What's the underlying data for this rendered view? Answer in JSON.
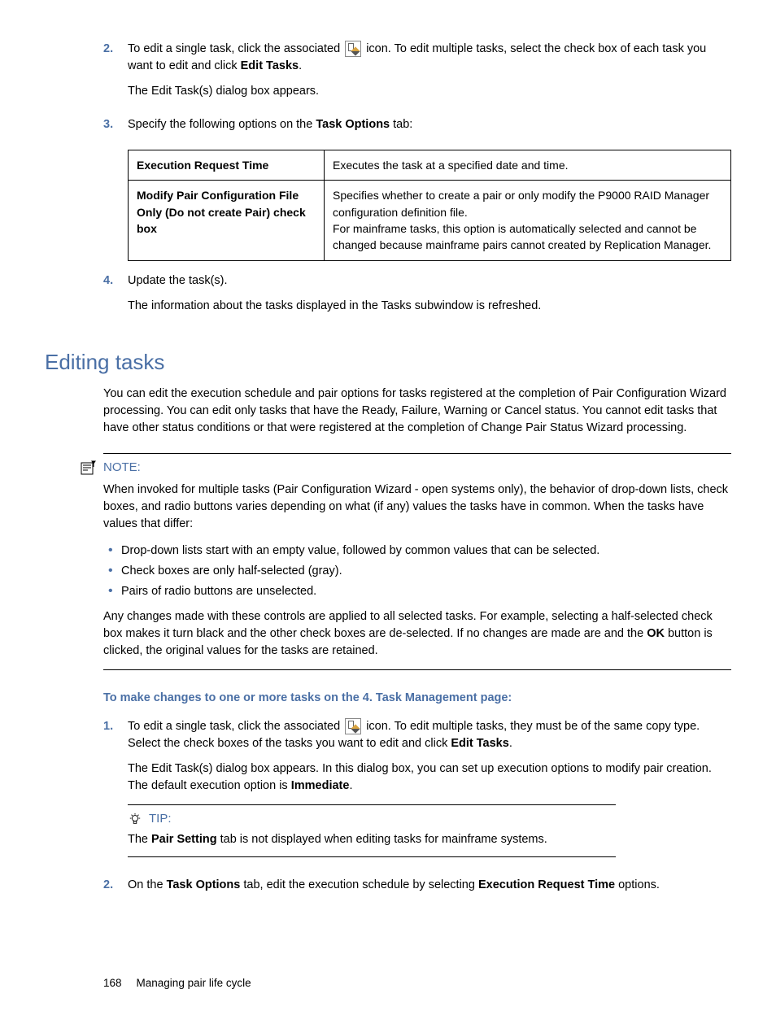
{
  "steps_top": {
    "s2": {
      "marker": "2.",
      "text_a": "To edit a single task, click the associated ",
      "text_b": " icon. To edit multiple tasks, select the check box of each task you want to edit and click ",
      "bold_b": "Edit Tasks",
      "text_c": ".",
      "p2": "The Edit Task(s) dialog box appears."
    },
    "s3": {
      "marker": "3.",
      "text_a": "Specify the following options on the ",
      "bold_a": "Task Options",
      "text_b": " tab:"
    },
    "s4": {
      "marker": "4.",
      "text_a": "Update the task(s).",
      "p2": "The information about the tasks displayed in the Tasks subwindow is refreshed."
    }
  },
  "table": {
    "r1h": "Execution Request Time",
    "r1v": "Executes the task at a specified date and time.",
    "r2h": "Modify Pair Configuration File Only (Do not create Pair) check box",
    "r2v_a": "Specifies whether to create a pair or only modify the P9000 RAID Manager configuration definition file.",
    "r2v_b": "For mainframe tasks, this option is automatically selected and cannot be changed because mainframe pairs cannot created by Replication Manager."
  },
  "heading": "Editing tasks",
  "intro": "You can edit the execution schedule and pair options for tasks registered at the completion of Pair Configuration Wizard processing. You can edit only tasks that have the Ready, Failure, Warning or Cancel status. You cannot edit tasks that have other status conditions or that were registered at the completion of Change Pair Status Wizard processing.",
  "note": {
    "label": "NOTE:",
    "p1": "When invoked for multiple tasks (Pair Configuration Wizard - open systems only), the behavior of drop-down lists, check boxes, and radio buttons varies depending on what (if any) values the tasks have in common. When the tasks have values that differ:",
    "b1": "Drop-down lists start with an empty value, followed by common values that can be selected.",
    "b2": "Check boxes are only half-selected (gray).",
    "b3": "Pairs of radio buttons are unselected.",
    "p2_a": "Any changes made with these controls are applied to all selected tasks. For example, selecting a half-selected check box makes it turn black and the other check boxes are de-selected. If no changes are made are and the ",
    "p2_bold": "OK",
    "p2_b": " button is clicked, the original values for the tasks are retained."
  },
  "procedure_head": "To make changes to one or more tasks on the 4. Task Management page:",
  "steps_bottom": {
    "s1": {
      "marker": "1.",
      "text_a": "To edit a single task, click the associated ",
      "text_b": " icon. To edit multiple tasks, they must be of the same copy type. Select the check boxes of the tasks you want to edit and click ",
      "bold_b": "Edit Tasks",
      "text_c": ".",
      "p2_a": "The Edit Task(s) dialog box appears. In this dialog box, you can set up execution options to modify pair creation. The default execution option is ",
      "p2_bold": "Immediate",
      "p2_b": "."
    },
    "s2": {
      "marker": "2.",
      "text_a": "On the ",
      "bold_a": "Task Options",
      "text_b": " tab, edit the execution schedule by selecting ",
      "bold_b": "Execution Request Time",
      "text_c": " options."
    }
  },
  "tip": {
    "label": "TIP:",
    "text_a": "The ",
    "bold_a": "Pair Setting",
    "text_b": " tab is not displayed when editing tasks for mainframe systems."
  },
  "footer": {
    "page": "168",
    "title": "Managing pair life cycle"
  }
}
